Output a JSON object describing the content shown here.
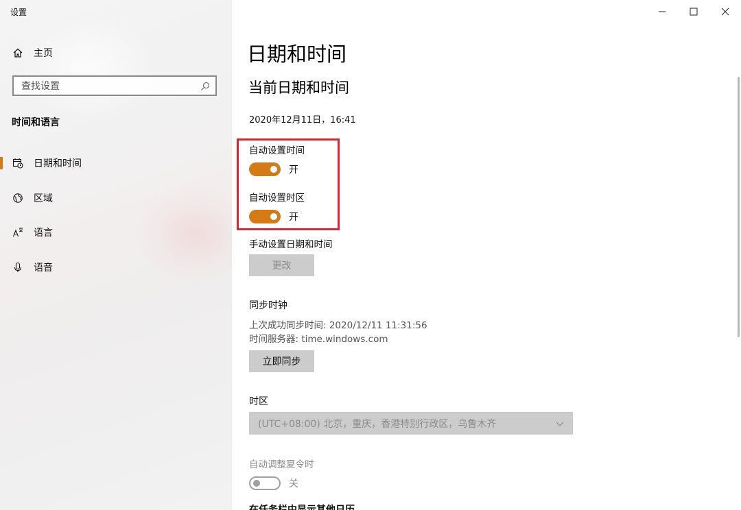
{
  "window": {
    "app_title": "设置",
    "controls": {
      "minimize_icon": "minimize-icon",
      "maximize_icon": "maximize-icon",
      "close_icon": "close-icon"
    }
  },
  "sidebar": {
    "home_label": "主页",
    "search_placeholder": "查找设置",
    "section_title": "时间和语言",
    "items": [
      {
        "label": "日期和时间",
        "icon": "calendar-clock-icon",
        "active": true
      },
      {
        "label": "区域",
        "icon": "globe-icon",
        "active": false
      },
      {
        "label": "语言",
        "icon": "language-icon",
        "active": false
      },
      {
        "label": "语音",
        "icon": "microphone-icon",
        "active": false
      }
    ]
  },
  "main": {
    "page_title": "日期和时间",
    "current_heading": "当前日期和时间",
    "current_datetime": "2020年12月11日，16:41",
    "auto_time_label": "自动设置时间",
    "auto_time_state": "开",
    "auto_timezone_label": "自动设置时区",
    "auto_timezone_state": "开",
    "manual_label": "手动设置日期和时间",
    "change_button": "更改",
    "sync_label": "同步时钟",
    "last_sync": "上次成功同步时间: 2020/12/11 11:31:56",
    "time_server": "时间服务器: time.windows.com",
    "sync_now_button": "立即同步",
    "timezone_label": "时区",
    "timezone_value": "(UTC+08:00) 北京，重庆，香港特别行政区，乌鲁木齐",
    "dst_label": "自动调整夏令时",
    "dst_state": "关",
    "extra_calendar_heading": "在任务栏中显示其他日历"
  },
  "colors": {
    "accent": "#d47a17",
    "highlight_border": "#e0232e",
    "button_bg": "#cccccc"
  }
}
